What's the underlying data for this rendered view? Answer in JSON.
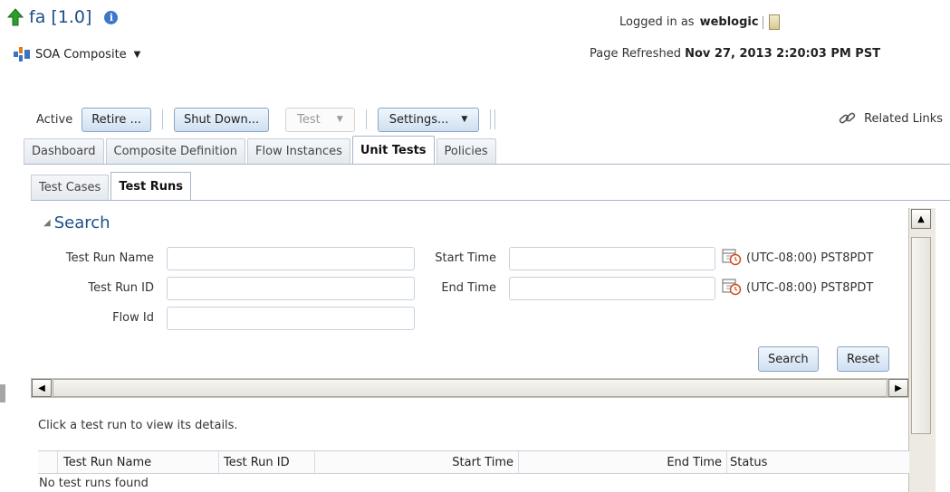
{
  "header": {
    "title": "fa [1.0]",
    "composite_menu": "SOA Composite",
    "logged_in_prefix": "Logged in as",
    "user": "weblogic",
    "refreshed_prefix": "Page Refreshed",
    "refreshed_time": "Nov 27, 2013 2:20:03 PM PST"
  },
  "toolbar": {
    "status": "Active",
    "retire": "Retire ...",
    "shutdown": "Shut Down...",
    "test": "Test",
    "settings": "Settings...",
    "related_links": "Related Links"
  },
  "tabs": [
    "Dashboard",
    "Composite Definition",
    "Flow Instances",
    "Unit Tests",
    "Policies"
  ],
  "subtabs": [
    "Test Cases",
    "Test Runs"
  ],
  "search": {
    "title": "Search",
    "test_run_name_label": "Test Run Name",
    "test_run_id_label": "Test Run ID",
    "flow_id_label": "Flow Id",
    "start_time_label": "Start Time",
    "end_time_label": "End Time",
    "timezone": "(UTC-08:00) PST8PDT",
    "search_btn": "Search",
    "reset_btn": "Reset"
  },
  "results": {
    "hint": "Click a test run to view its details.",
    "columns": [
      "Test Run Name",
      "Test Run ID",
      "Start Time",
      "End Time",
      "Status"
    ],
    "empty_text": "No test runs found"
  },
  "colors": {
    "title_blue": "#1b4f89",
    "button_border": "#8aa6c5",
    "tab_border": "#a7b6c7"
  }
}
